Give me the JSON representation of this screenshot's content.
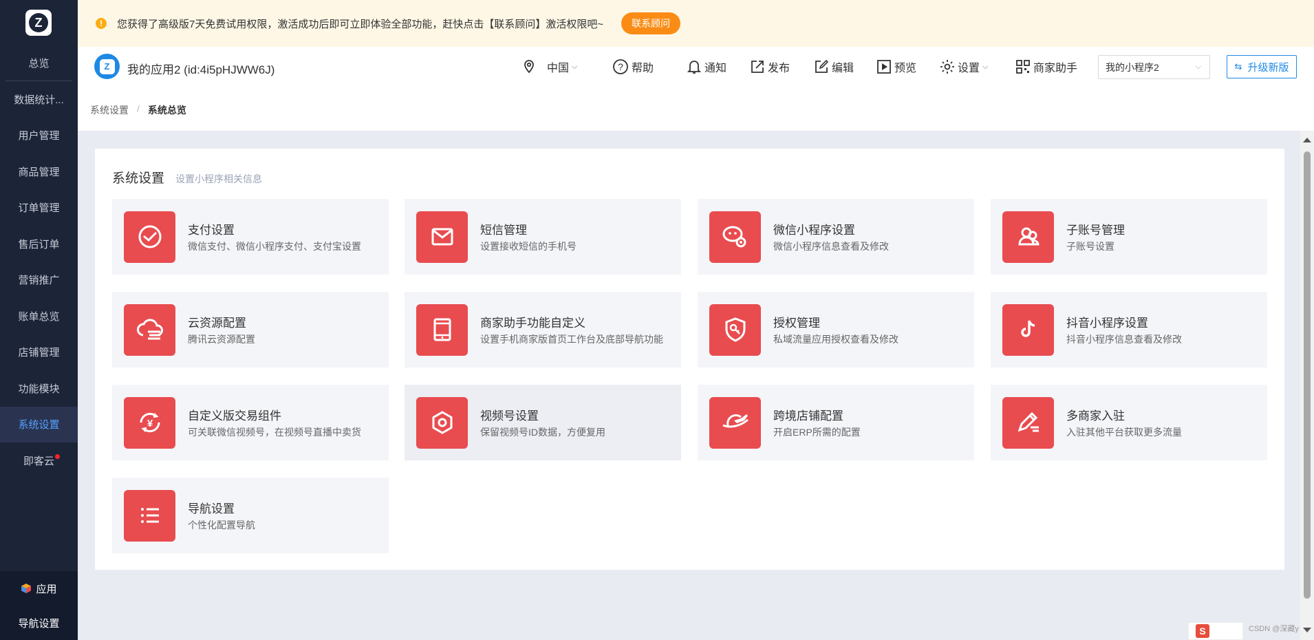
{
  "notice": {
    "text": "您获得了高级版7天免费试用权限，激活成功后即可立即体验全部功能，赶快点击【联系顾问】激活权限吧~",
    "button": "联系顾问"
  },
  "sidebar": {
    "logo_letter": "Z",
    "items": [
      {
        "label": "总览"
      },
      {
        "label": "数据统计..."
      },
      {
        "label": "用户管理"
      },
      {
        "label": "商品管理"
      },
      {
        "label": "订单管理"
      },
      {
        "label": "售后订单"
      },
      {
        "label": "营销推广"
      },
      {
        "label": "账单总览"
      },
      {
        "label": "店铺管理"
      },
      {
        "label": "功能模块"
      },
      {
        "label": "系统设置"
      },
      {
        "label": "即客云"
      }
    ],
    "bottom": {
      "apps": "应用",
      "nav": "导航设置"
    }
  },
  "header": {
    "app_name": "我的应用2  (id:4i5pHJWW6J)",
    "region": "中国",
    "help": "帮助",
    "notify": "通知",
    "publish": "发布",
    "edit": "编辑",
    "preview": "预览",
    "settings": "设置",
    "merchant": "商家助手",
    "selected_app": "我的小程序2",
    "upgrade": "升级新版"
  },
  "breadcrumb": {
    "parent": "系统设置",
    "sep": "/",
    "current": "系统总览"
  },
  "card": {
    "title": "系统设置",
    "subtitle": "设置小程序相关信息",
    "tiles": [
      {
        "title": "支付设置",
        "desc": "微信支付、微信小程序支付、支付宝设置",
        "icon": "payment-icon"
      },
      {
        "title": "短信管理",
        "desc": "设置接收短信的手机号",
        "icon": "mail-icon"
      },
      {
        "title": "微信小程序设置",
        "desc": "微信小程序信息查看及修改",
        "icon": "wechat-settings-icon"
      },
      {
        "title": "子账号管理",
        "desc": "子账号设置",
        "icon": "users-icon"
      },
      {
        "title": "云资源配置",
        "desc": "腾讯云资源配置",
        "icon": "cloud-icon"
      },
      {
        "title": "商家助手功能自定义",
        "desc": "设置手机商家版首页工作台及底部导航功能",
        "icon": "tablet-icon"
      },
      {
        "title": "授权管理",
        "desc": "私域流量应用授权查看及修改",
        "icon": "shield-key-icon"
      },
      {
        "title": "抖音小程序设置",
        "desc": "抖音小程序信息查看及修改",
        "icon": "tiktok-icon"
      },
      {
        "title": "自定义版交易组件",
        "desc": "可关联微信视频号，在视频号直播中卖货",
        "icon": "yen-cycle-icon"
      },
      {
        "title": "视频号设置",
        "desc": "保留视频号ID数据，方便复用",
        "icon": "hexagon-icon"
      },
      {
        "title": "跨境店铺配置",
        "desc": "开启ERP所需的配置",
        "icon": "plane-icon"
      },
      {
        "title": "多商家入驻",
        "desc": "入驻其他平台获取更多流量",
        "icon": "pen-icon"
      },
      {
        "title": "导航设置",
        "desc": "个性化配置导航",
        "icon": "list-icon"
      }
    ]
  },
  "watermark": "CSDN @深藏y",
  "colors": {
    "accent_red": "#e84c4f",
    "sidebar_bg": "#1c2438",
    "primary_blue": "#1e88e5",
    "notice_btn": "#fa8c16"
  }
}
